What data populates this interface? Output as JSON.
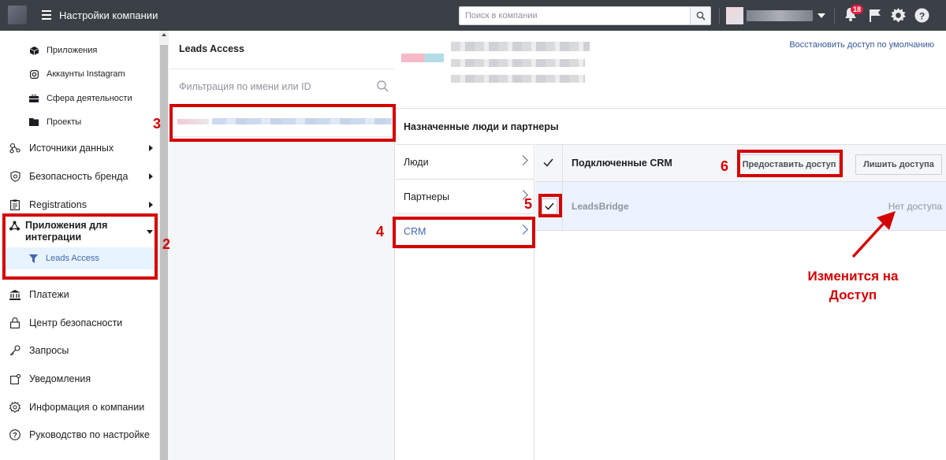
{
  "topbar": {
    "title": "Настройки компании",
    "search_placeholder": "Поиск в компании",
    "notification_count": "18"
  },
  "sidebar": {
    "sub_items": [
      {
        "label": "Приложения",
        "icon": "cube-icon"
      },
      {
        "label": "Аккаунты Instagram",
        "icon": "instagram-icon"
      },
      {
        "label": "Сфера деятельности",
        "icon": "briefcase-icon"
      },
      {
        "label": "Проекты",
        "icon": "folder-icon"
      }
    ],
    "main_items": [
      {
        "label": "Источники данных",
        "icon": "data-sources-icon"
      },
      {
        "label": "Безопасность бренда",
        "icon": "shield-icon"
      },
      {
        "label": "Registrations",
        "icon": "clipboard-icon"
      }
    ],
    "active_group": {
      "label": "Приложения для интеграции",
      "child": "Leads Access"
    },
    "lower_items": [
      {
        "label": "Платежи",
        "icon": "bank-icon"
      },
      {
        "label": "Центр безопасности",
        "icon": "lock-icon"
      },
      {
        "label": "Запросы",
        "icon": "key-icon"
      },
      {
        "label": "Уведомления",
        "icon": "notifications-icon"
      },
      {
        "label": "Информация о компании",
        "icon": "gear-icon"
      },
      {
        "label": "Руководство по настройке",
        "icon": "question-icon"
      }
    ]
  },
  "middle": {
    "title": "Leads Access",
    "filter_placeholder": "Фильтрация по имени или ID"
  },
  "right": {
    "restore_link": "Восстановить доступ по умолчанию",
    "assigned_title": "Назначенные люди и партнеры",
    "tabs": [
      "Люди",
      "Партнеры",
      "CRM"
    ],
    "table_title": "Подключенные CRM",
    "grant_button": "Предоставить доступ",
    "revoke_button": "Лишить доступа",
    "rows": [
      {
        "name": "LeadsBridge",
        "status": "Нет доступа"
      }
    ]
  },
  "annotations": {
    "numbers": [
      "2",
      "3",
      "4",
      "5",
      "6"
    ],
    "note_line1": "Изменится на",
    "note_line2": "Доступ",
    "accent_color": "#d40000"
  }
}
